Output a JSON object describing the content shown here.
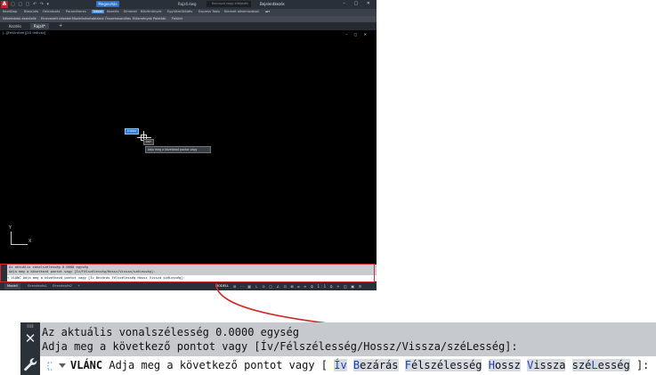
{
  "app": {
    "logo": "A",
    "qat": "▢ ▢ ▢ ↶ ↷ ▾",
    "share_label": "Megosztás",
    "doc_title": "Rajz4.dwg",
    "search_placeholder": "Kulcsszó vagy kifejezés",
    "user": "Bejelentkezés",
    "window_controls": "– ▢ ✕",
    "ribbon_tabs": [
      "Kezdőlap",
      "Beszúrás",
      "Feliratozás",
      "Paraméteres",
      "Nézet",
      "Kezelés",
      "Kimenet",
      "Bővítmények",
      "Együttműködés",
      "Express Tools",
      "Kiemelt alkalmazások"
    ],
    "ribbon_active_tab": "Nézet",
    "panels": [
      "Nézetablak-eszközök",
      "Elnevezett nézetek",
      "Modellnézetablakok",
      "Összehasonlítás",
      "Előzmények",
      "Paletták",
      "Felület"
    ],
    "file_tabs": [
      "Kezdés",
      "Rajz4*"
    ],
    "file_tab_active": "Rajz4*",
    "plus": "+",
    "viewport_label": "[–][Felülnézet][2D drótváz]",
    "viewport_controls": "– ▢ ✕",
    "dyn_input_1": "0.0000",
    "dyn_input_2": "180°",
    "tooltip": "Adja meg a következő pontot vagy",
    "ucs_y": "Y",
    "ucs_x": "X",
    "mini_cmd_line1": "Az aktuális vonalszélesség 0.0000 egység",
    "mini_cmd_line2": "Adja meg a következő pontot vagy [Ív/Félszélesség/Hossz/Vissza/széLesség]:",
    "mini_cmd_line3": "▾ VLÁNC Adja meg a következő pontot vagy [Ív Bezárás Félszélesség Hossz Vissza széLesség]:",
    "layout_tabs": [
      "Modell",
      "Elrendezés1",
      "Elrendezés2",
      "+"
    ],
    "layout_tab_active": "Modell",
    "status_model": "MODELL",
    "status_icons": "⊞ ⋯ ▦ ∟ ⊙ ▢ ∠ ⊡ ⊠ ⌀ ≡ ⛭ 1:1 ⛭ + ◫ ▣ ☰"
  },
  "zoom": {
    "line1": "Az aktuális vonalszélesség 0.0000 egység",
    "line2": "Adja meg a következő pontot vagy [Ív/Félszélesség/Hossz/Vissza/széLesség]:",
    "command_name": "VLÁNC",
    "prompt_text": "Adja meg a következő pontot vagy [",
    "options": [
      {
        "pre": "",
        "key": "Ív",
        "post": ""
      },
      {
        "pre": "",
        "key": "B",
        "post": "ezárás"
      },
      {
        "pre": "",
        "key": "F",
        "post": "élszélesség"
      },
      {
        "pre": "",
        "key": "H",
        "post": "ossz"
      },
      {
        "pre": "",
        "key": "V",
        "post": "issza"
      },
      {
        "pre": "szé",
        "key": "L",
        "post": "esség"
      }
    ],
    "prompt_end": "]:"
  },
  "colors": {
    "highlight": "#d12b2b",
    "option_key": "#1f3fb8",
    "command_bg": "#c6cacf",
    "grip_bg": "#2b3138"
  }
}
